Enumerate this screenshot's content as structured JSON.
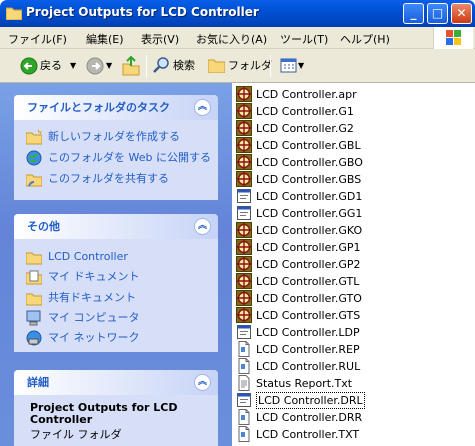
{
  "window": {
    "title": "Project Outputs for LCD Controller",
    "min_label": "_",
    "max_label": "□",
    "close_label": "✕"
  },
  "menubar": {
    "items": [
      "ファイル(F)",
      "編集(E)",
      "表示(V)",
      "お気に入り(A)",
      "ツール(T)",
      "ヘルプ(H)"
    ]
  },
  "toolbar": {
    "back": "戻る",
    "search": "検索",
    "folders": "フォルダ"
  },
  "tasks": {
    "title": "ファイルとフォルダのタスク",
    "items": [
      "新しいフォルダを作成する",
      "このフォルダを Web に公開する",
      "このフォルダを共有する"
    ]
  },
  "other": {
    "title": "その他",
    "items": [
      "LCD Controller",
      "マイ ドキュメント",
      "共有ドキュメント",
      "マイ コンピュータ",
      "マイ ネットワーク"
    ]
  },
  "details": {
    "title": "詳細",
    "name": "Project Outputs for LCD Controller",
    "type": "ファイル フォルダ"
  },
  "files": [
    {
      "name": "LCD Controller.apr",
      "icon": "gerber-icon"
    },
    {
      "name": "LCD Controller.G1",
      "icon": "gerber-icon"
    },
    {
      "name": "LCD Controller.G2",
      "icon": "gerber-icon"
    },
    {
      "name": "LCD Controller.GBL",
      "icon": "gerber-icon"
    },
    {
      "name": "LCD Controller.GBO",
      "icon": "gerber-icon"
    },
    {
      "name": "LCD Controller.GBS",
      "icon": "gerber-icon"
    },
    {
      "name": "LCD Controller.GD1",
      "icon": "window-file-icon"
    },
    {
      "name": "LCD Controller.GG1",
      "icon": "window-file-icon"
    },
    {
      "name": "LCD Controller.GKO",
      "icon": "gerber-icon"
    },
    {
      "name": "LCD Controller.GP1",
      "icon": "gerber-icon"
    },
    {
      "name": "LCD Controller.GP2",
      "icon": "gerber-icon"
    },
    {
      "name": "LCD Controller.GTL",
      "icon": "gerber-icon"
    },
    {
      "name": "LCD Controller.GTO",
      "icon": "gerber-icon"
    },
    {
      "name": "LCD Controller.GTS",
      "icon": "gerber-icon"
    },
    {
      "name": "LCD Controller.LDP",
      "icon": "window-file-icon"
    },
    {
      "name": "LCD Controller.REP",
      "icon": "document-icon"
    },
    {
      "name": "LCD Controller.RUL",
      "icon": "document-icon"
    },
    {
      "name": "Status Report.Txt",
      "icon": "text-file-icon"
    },
    {
      "name": "LCD Controller.DRL",
      "icon": "window-file-icon",
      "selected": true
    },
    {
      "name": "LCD Controller.DRR",
      "icon": "document-icon"
    },
    {
      "name": "LCD Controller.TXT",
      "icon": "document-icon"
    }
  ]
}
